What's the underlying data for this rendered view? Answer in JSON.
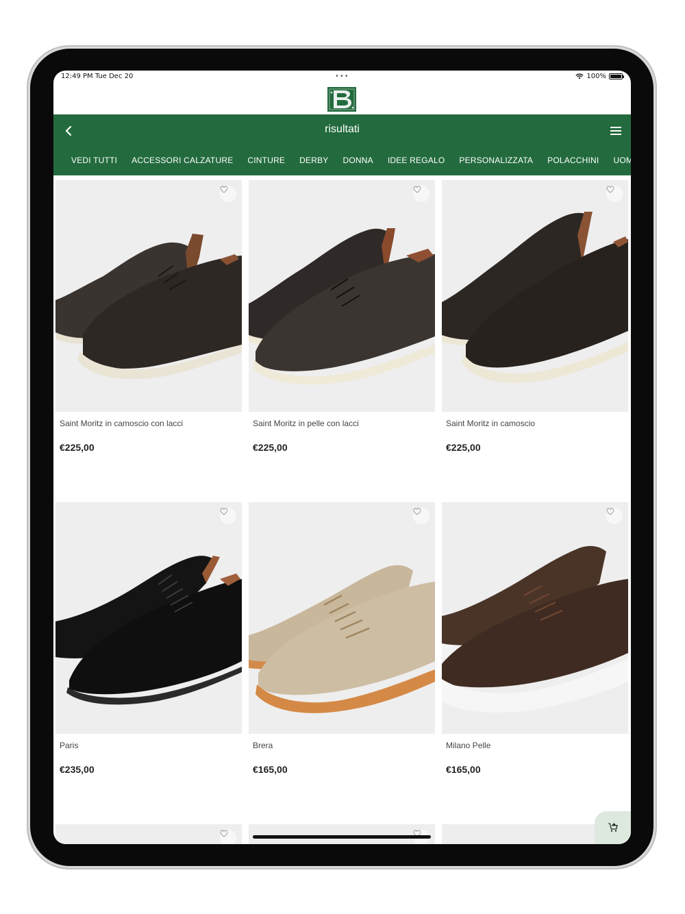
{
  "status_bar": {
    "time": "12:49 PM  Tue Dec 20",
    "battery": "100%",
    "battery_level": 1.0
  },
  "header": {
    "title": "risultati",
    "categories": [
      "VEDI TUTTI",
      "ACCESSORI CALZATURE",
      "CINTURE",
      "DERBY",
      "DONNA",
      "IDEE REGALO",
      "PERSONALIZZATA",
      "POLACCHINI",
      "UOMO"
    ]
  },
  "products": [
    {
      "name": "Saint Moritz in camoscio con lacci",
      "price": "€225,00"
    },
    {
      "name": "Saint Moritz in pelle con lacci",
      "price": "€225,00"
    },
    {
      "name": "Saint Moritz in camoscio",
      "price": "€225,00"
    },
    {
      "name": "Paris",
      "price": "€235,00"
    },
    {
      "name": "Brera",
      "price": "€165,00"
    },
    {
      "name": "Milano Pelle",
      "price": "€165,00"
    }
  ],
  "colors": {
    "brand_green": "#236b3e",
    "cart_bg": "#dde8df"
  },
  "icons": {
    "back": "chevron-left-icon",
    "menu": "hamburger-menu-icon",
    "favorite": "heart-outline-icon",
    "cart": "add-to-cart-icon",
    "wifi": "wifi-icon",
    "battery": "battery-icon"
  }
}
